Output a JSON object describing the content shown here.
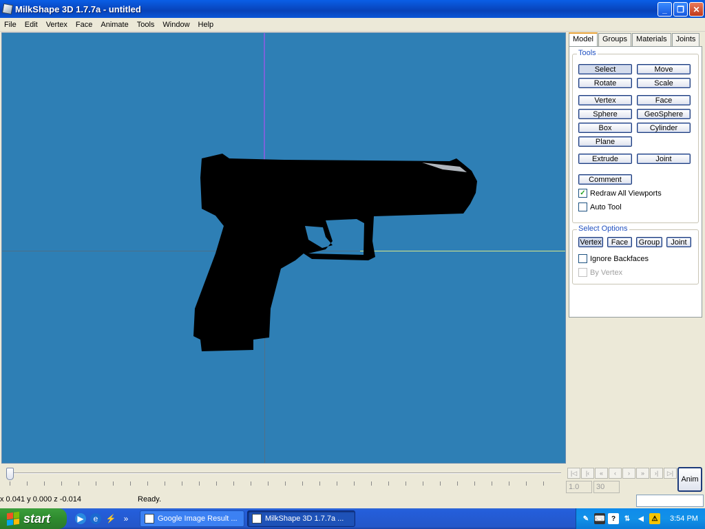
{
  "window": {
    "title": "MilkShape 3D 1.7.7a - untitled"
  },
  "menu": [
    "File",
    "Edit",
    "Vertex",
    "Face",
    "Animate",
    "Tools",
    "Window",
    "Help"
  ],
  "tabs": [
    "Model",
    "Groups",
    "Materials",
    "Joints"
  ],
  "tools": {
    "label": "Tools",
    "select": "Select",
    "move": "Move",
    "rotate": "Rotate",
    "scale": "Scale",
    "vertex": "Vertex",
    "face": "Face",
    "sphere": "Sphere",
    "geosphere": "GeoSphere",
    "box": "Box",
    "cylinder": "Cylinder",
    "plane": "Plane",
    "extrude": "Extrude",
    "joint": "Joint",
    "comment": "Comment",
    "redraw_all": "Redraw All Viewports",
    "auto_tool": "Auto Tool"
  },
  "select_options": {
    "label": "Select Options",
    "vertex": "Vertex",
    "face": "Face",
    "group": "Group",
    "joint": "Joint",
    "ignore_backfaces": "Ignore Backfaces",
    "by_vertex": "By Vertex"
  },
  "timeline": {
    "frame": "1.0",
    "total": "30",
    "anim": "Anim"
  },
  "status": {
    "coords": "x 0.041 y 0.000 z -0.014",
    "text": "Ready."
  },
  "taskbar": {
    "start": "start",
    "tasks": [
      "Google Image Result ...",
      "MilkShape 3D 1.7.7a ..."
    ],
    "clock": "3:54 PM"
  },
  "colors": {
    "viewport_bg": "#2E7FB5",
    "titlebar": "#0A5FE6"
  }
}
